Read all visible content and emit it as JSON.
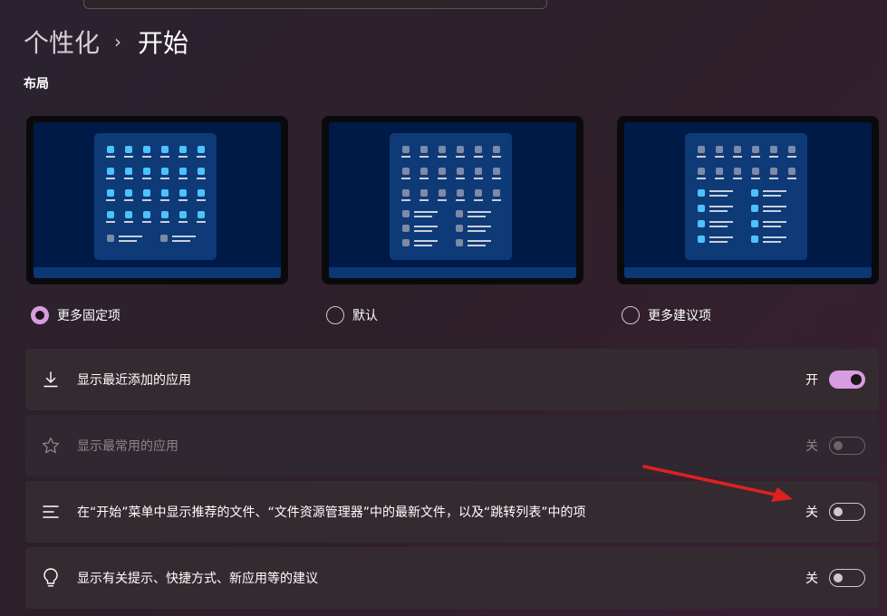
{
  "breadcrumb": {
    "parent": "个性化",
    "separator": "›",
    "current": "开始"
  },
  "layout": {
    "heading": "布局",
    "options": [
      {
        "label": "更多固定项",
        "selected": true
      },
      {
        "label": "默认",
        "selected": false
      },
      {
        "label": "更多建议项",
        "selected": false
      }
    ]
  },
  "settings": [
    {
      "icon": "download-icon",
      "label": "显示最近添加的应用",
      "state_text": "开",
      "on": true,
      "disabled": false
    },
    {
      "icon": "star-icon",
      "label": "显示最常用的应用",
      "state_text": "关",
      "on": false,
      "disabled": true
    },
    {
      "icon": "lines-icon",
      "label": "在“开始”菜单中显示推荐的文件、“文件资源管理器”中的最新文件，以及“跳转列表”中的项",
      "state_text": "关",
      "on": false,
      "disabled": false
    },
    {
      "icon": "lightbulb-icon",
      "label": "显示有关提示、快捷方式、新应用等的建议",
      "state_text": "关",
      "on": false,
      "disabled": false
    }
  ],
  "colors": {
    "accent": "#d89ce0",
    "annotation_arrow": "#e02020"
  }
}
